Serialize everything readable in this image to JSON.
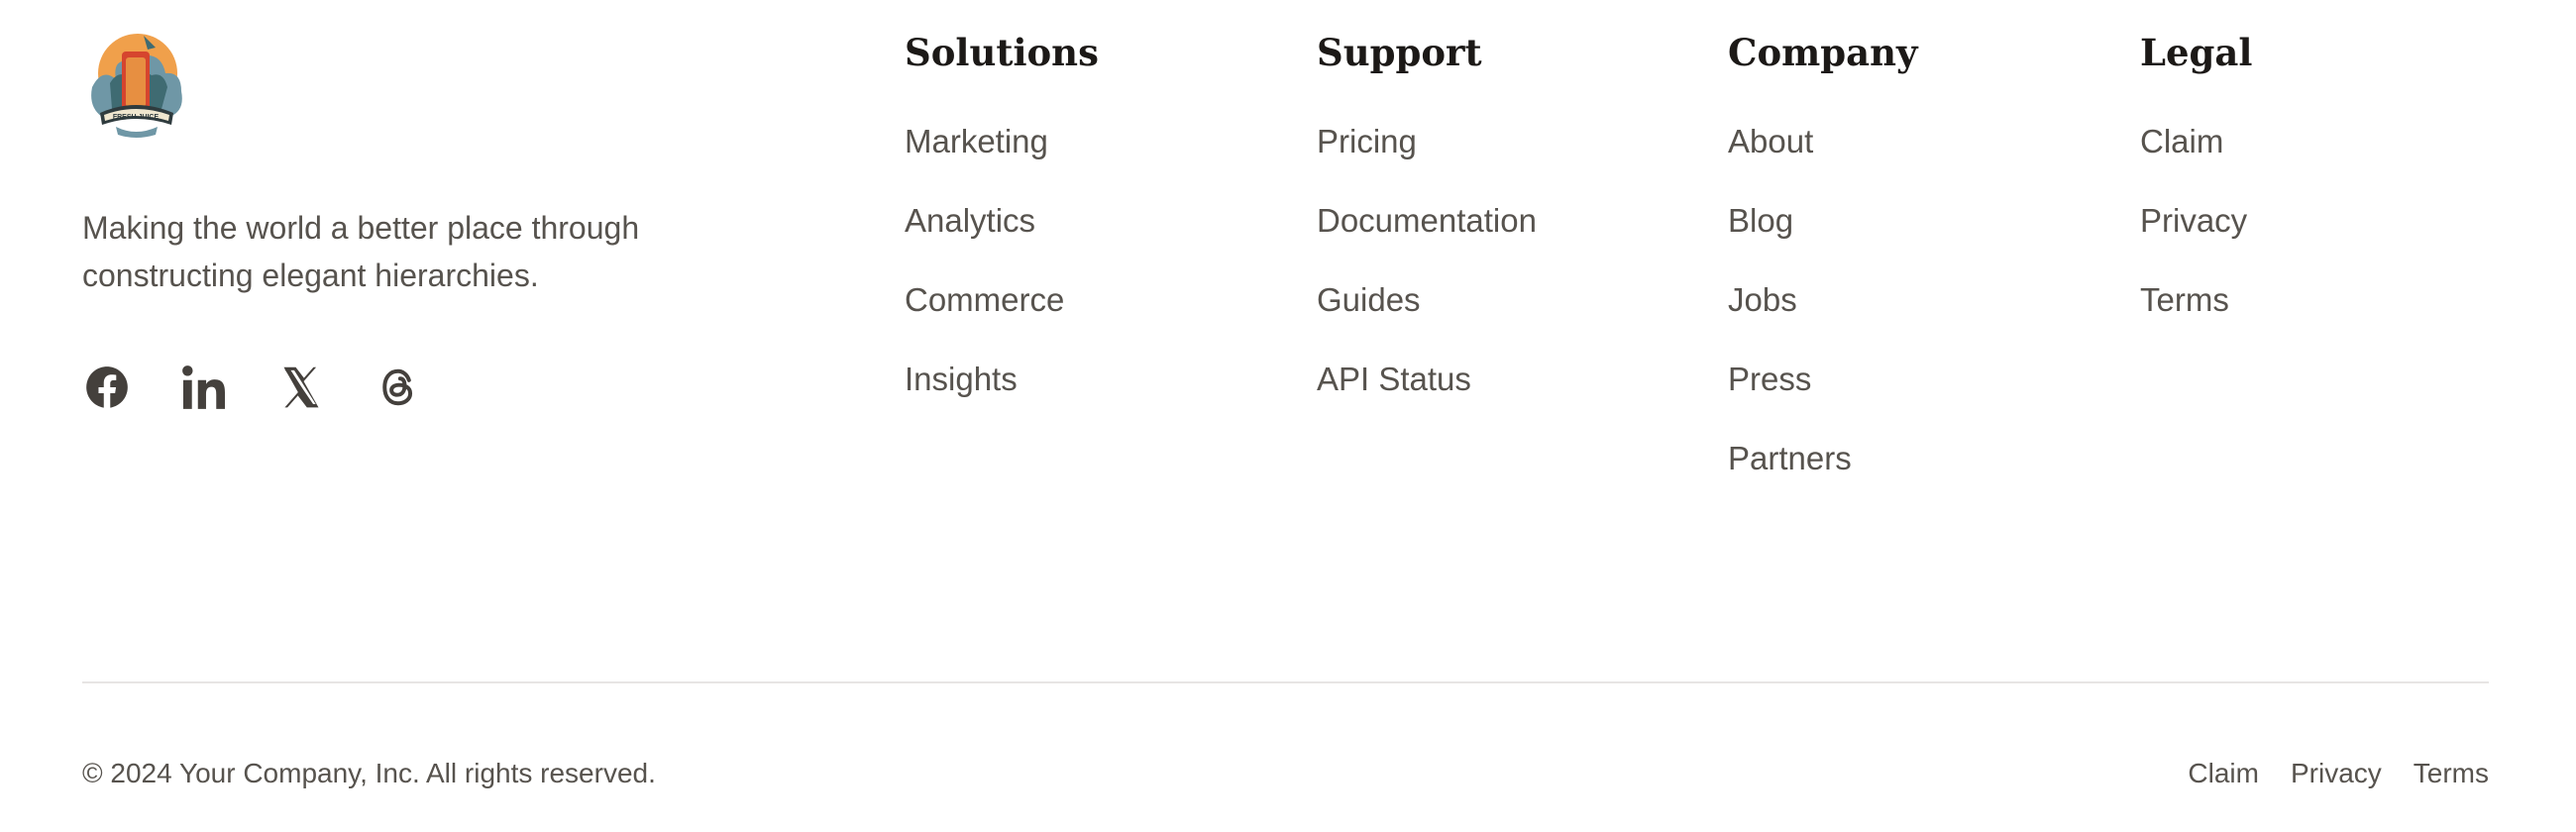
{
  "brand": {
    "logo_icon": "fresh-juice-logo",
    "logo_text": "FRESH JUICE",
    "tagline": "Making the world a better place through constructing elegant hierarchies.",
    "socials": [
      {
        "name": "facebook-icon"
      },
      {
        "name": "linkedin-icon"
      },
      {
        "name": "x-icon"
      },
      {
        "name": "threads-icon"
      }
    ]
  },
  "columns": {
    "solutions": {
      "heading": "Solutions",
      "links": [
        "Marketing",
        "Analytics",
        "Commerce",
        "Insights"
      ]
    },
    "support": {
      "heading": "Support",
      "links": [
        "Pricing",
        "Documentation",
        "Guides",
        "API Status"
      ]
    },
    "company": {
      "heading": "Company",
      "links": [
        "About",
        "Blog",
        "Jobs",
        "Press",
        "Partners"
      ]
    },
    "legal": {
      "heading": "Legal",
      "links": [
        "Claim",
        "Privacy",
        "Terms"
      ]
    }
  },
  "bottom": {
    "copyright": "© 2024 Your Company, Inc. All rights reserved.",
    "links": [
      "Claim",
      "Privacy",
      "Terms"
    ]
  },
  "colors": {
    "text": "#57534e",
    "heading": "#1c1917",
    "divider": "#e7e5e4",
    "logo_sun": "#f0a04b"
  }
}
